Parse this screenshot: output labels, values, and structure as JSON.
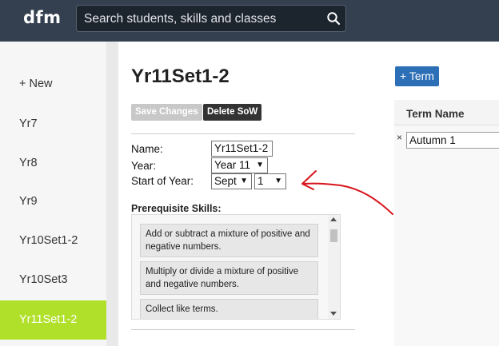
{
  "app": {
    "logo": "dfm"
  },
  "search": {
    "placeholder": "Search students, skills and classes"
  },
  "sidebar": {
    "items": [
      {
        "label": "+ New",
        "active": false
      },
      {
        "label": "Yr7",
        "active": false
      },
      {
        "label": "Yr8",
        "active": false
      },
      {
        "label": "Yr9",
        "active": false
      },
      {
        "label": "Yr10Set1-2",
        "active": false
      },
      {
        "label": "Yr10Set3",
        "active": false
      },
      {
        "label": "Yr11Set1-2",
        "active": true
      }
    ]
  },
  "main": {
    "title": "Yr11Set1-2",
    "save_label": "Save Changes",
    "delete_label": "Delete SoW",
    "form": {
      "name_label": "Name:",
      "name_value": "Yr11Set1-2",
      "year_label": "Year:",
      "year_value": "Year 11",
      "start_label": "Start of Year:",
      "start_month": "Sept",
      "start_day": "1"
    },
    "prereq_title": "Prerequisite Skills:",
    "skills": [
      "Add or subtract a mixture of positive and negative numbers.",
      "Multiply or divide a mixture of positive and negative numbers.",
      "Collect like terms."
    ]
  },
  "terms": {
    "add_label": "+ Term",
    "column_header": "Term Name",
    "rows": [
      {
        "remove": "×",
        "name": "Autumn 1"
      }
    ]
  },
  "colors": {
    "topbar": "#34404f",
    "active_item": "#b0e02a",
    "primary_button": "#2c6fb7",
    "annotation_arrow": "#d8141c"
  }
}
